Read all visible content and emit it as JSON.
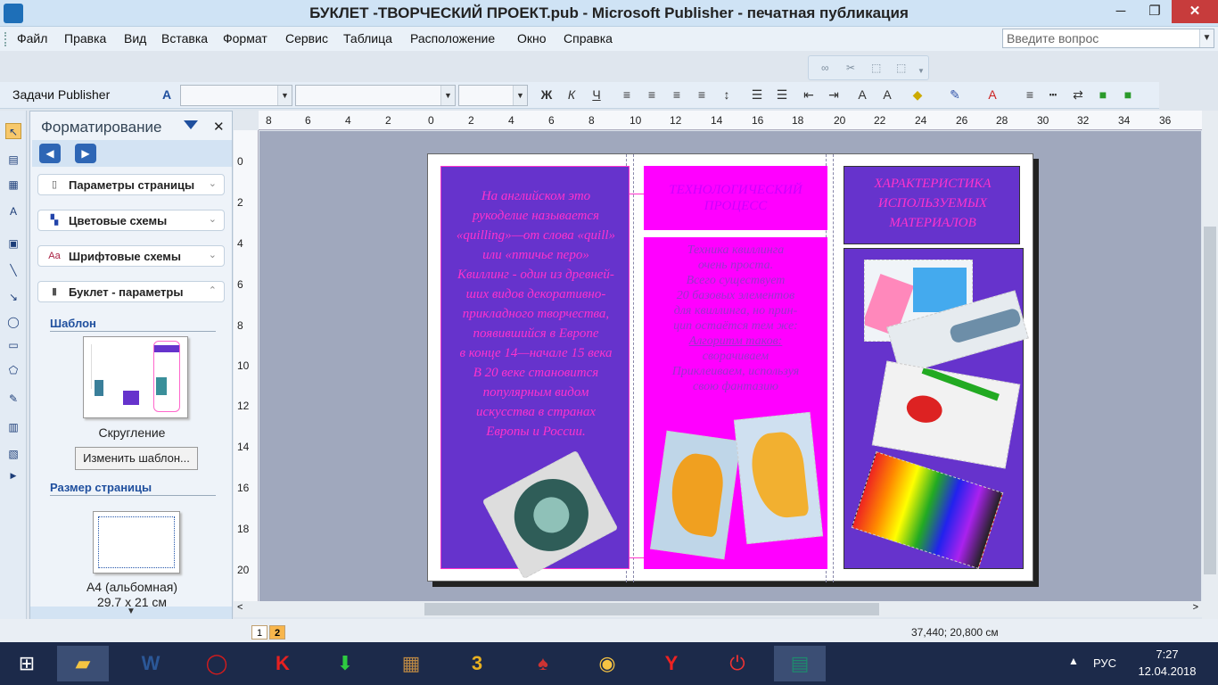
{
  "window": {
    "title": "БУКЛЕТ -ТВОРЧЕСКИЙ ПРОЕКТ.pub - Microsoft Publisher - печатная публикация",
    "min": "─",
    "max": "❐",
    "close": "✕"
  },
  "menu": [
    "Файл",
    "Правка",
    "Вид",
    "Вставка",
    "Формат",
    "Сервис",
    "Таблица",
    "Расположение",
    "Окно",
    "Справка"
  ],
  "ask_box": {
    "placeholder": "Введите вопрос"
  },
  "toolbar2": {
    "tasks_label": "Задачи Publisher",
    "bold": "Ж",
    "italic": "К",
    "underline": "Ч"
  },
  "task_pane": {
    "title": "Форматирование",
    "sections": [
      {
        "label": "Параметры страницы",
        "icon": "page-icon"
      },
      {
        "label": "Цветовые схемы",
        "icon": "color-scheme-icon"
      },
      {
        "label": "Шрифтовые схемы",
        "icon": "font-scheme-icon"
      },
      {
        "label": "Буклет - параметры",
        "icon": "booklet-icon"
      }
    ],
    "template_heading": "Шаблон",
    "template_name": "Скругление",
    "change_template": "Изменить шаблон...",
    "page_size_heading": "Размер страницы",
    "page_size_name": "A4 (альбомная)",
    "page_size_dims": "29,7 x 21 см"
  },
  "ruler": {
    "h": [
      "8",
      "6",
      "4",
      "2",
      "0",
      "2",
      "4",
      "6",
      "8",
      "10",
      "12",
      "14",
      "16",
      "18",
      "20",
      "22",
      "24",
      "26",
      "28",
      "30",
      "32",
      "34",
      "36"
    ],
    "v": [
      "0",
      "2",
      "4",
      "6",
      "8",
      "10",
      "12",
      "14",
      "16",
      "18",
      "20"
    ]
  },
  "booklet": {
    "left_text": [
      "На английском это",
      "рукоделие называется",
      "«quilling»—от слова «quill»",
      "или   «птичье перо»",
      "Квиллинг - один из древней-",
      "ших видов   декоративно-",
      "прикладного творчества,",
      "появившийся  в Европе",
      "в конце 14—начале 15 века",
      "В 20 веке становится",
      "популярным видом",
      "искусства в странах",
      "Европы и России."
    ],
    "mid_title": "ТЕХНОЛОГИЧЕСКИЙ ПРОЦЕСС",
    "mid_text": [
      "Техника  квиллинга",
      "очень проста.",
      "Всего существует",
      "20 базовых элементов",
      "для квиллинга, но   прин-",
      "цип остаётся тем же:",
      "Алгоритм таков:",
      "сворачиваем",
      "Приклеиваем, используя",
      "свою фантазию"
    ],
    "right_title": "ХАРАКТЕРИСТИКА ИСПОЛЬЗУЕМЫХ МАТЕРИАЛОВ",
    "colors": {
      "purple": "#6633cc",
      "magenta": "#ff00ff",
      "text_pink": "#ff33cc"
    }
  },
  "status": {
    "page1": "1",
    "page2": "2",
    "coords": "37,440; 20,800 см"
  },
  "taskbar": {
    "apps": [
      "windows-start",
      "file-explorer",
      "word",
      "opera",
      "kaspersky",
      "downloader",
      "winrar",
      "game-3",
      "solitaire",
      "chrome",
      "yandex",
      "power",
      "publisher"
    ],
    "lang": "РУС",
    "time": "7:27",
    "date": "12.04.2018"
  }
}
